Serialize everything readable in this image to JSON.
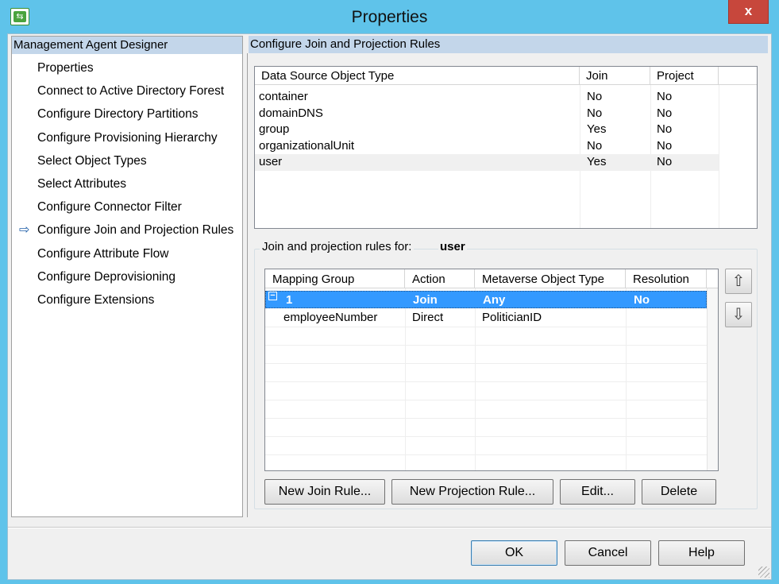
{
  "window": {
    "title": "Properties",
    "close_glyph": "x",
    "icon": "management-agent-icon"
  },
  "left_pane": {
    "header": "Management Agent Designer",
    "items": [
      {
        "label": "Properties"
      },
      {
        "label": "Connect to Active Directory Forest"
      },
      {
        "label": "Configure Directory Partitions"
      },
      {
        "label": "Configure Provisioning Hierarchy"
      },
      {
        "label": "Select Object Types"
      },
      {
        "label": "Select Attributes"
      },
      {
        "label": "Configure Connector Filter"
      },
      {
        "label": "Configure Join and Projection Rules",
        "current": true
      },
      {
        "label": "Configure Attribute Flow"
      },
      {
        "label": "Configure Deprovisioning"
      },
      {
        "label": "Configure Extensions"
      }
    ],
    "current_arrow": "⇨"
  },
  "right_pane": {
    "header": "Configure Join and Projection Rules",
    "object_types": {
      "columns": [
        "Data Source Object Type",
        "Join",
        "Project"
      ],
      "rows": [
        {
          "type": "container",
          "join": "No",
          "project": "No"
        },
        {
          "type": "domainDNS",
          "join": "No",
          "project": "No"
        },
        {
          "type": "group",
          "join": "Yes",
          "project": "No"
        },
        {
          "type": "organizationalUnit",
          "join": "No",
          "project": "No"
        },
        {
          "type": "user",
          "join": "Yes",
          "project": "No",
          "selected": true
        }
      ]
    },
    "rules": {
      "label": "Join and projection rules for:",
      "object": "user",
      "columns": [
        "Mapping Group",
        "Action",
        "Metaverse Object Type",
        "Resolution"
      ],
      "rows": [
        {
          "group": "1",
          "action": "Join",
          "mv_type": "Any",
          "resolution": "No",
          "selected": true,
          "expander": "−"
        },
        {
          "group": "employeeNumber",
          "action": "Direct",
          "mv_type": "PoliticianID",
          "resolution": ""
        }
      ],
      "move_up": "⇧",
      "move_down": "⇩",
      "buttons": {
        "new_join": "New Join Rule...",
        "new_projection": "New Projection Rule...",
        "edit": "Edit...",
        "delete": "Delete"
      }
    }
  },
  "footer": {
    "ok": "OK",
    "cancel": "Cancel",
    "help": "Help"
  }
}
